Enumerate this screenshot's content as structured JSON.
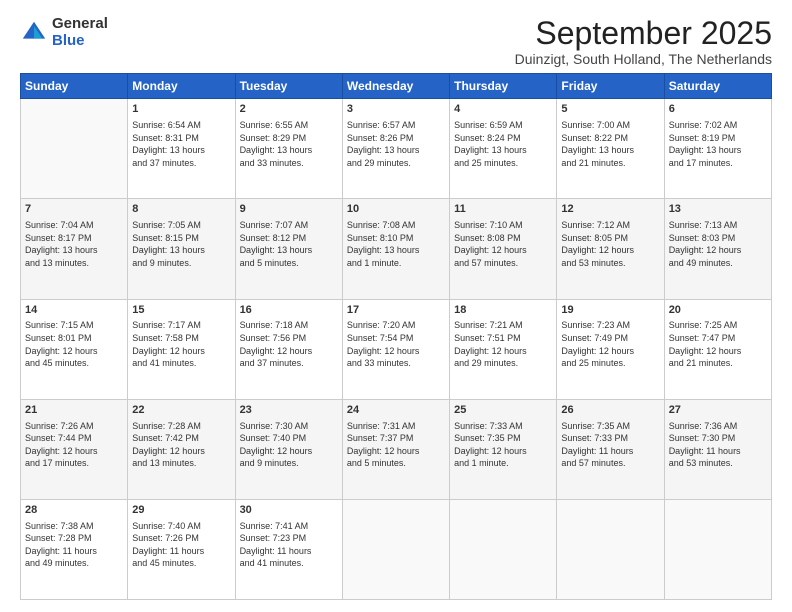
{
  "logo": {
    "general": "General",
    "blue": "Blue"
  },
  "title": "September 2025",
  "location": "Duinzigt, South Holland, The Netherlands",
  "days_of_week": [
    "Sunday",
    "Monday",
    "Tuesday",
    "Wednesday",
    "Thursday",
    "Friday",
    "Saturday"
  ],
  "weeks": [
    [
      {
        "num": "",
        "info": ""
      },
      {
        "num": "1",
        "info": "Sunrise: 6:54 AM\nSunset: 8:31 PM\nDaylight: 13 hours\nand 37 minutes."
      },
      {
        "num": "2",
        "info": "Sunrise: 6:55 AM\nSunset: 8:29 PM\nDaylight: 13 hours\nand 33 minutes."
      },
      {
        "num": "3",
        "info": "Sunrise: 6:57 AM\nSunset: 8:26 PM\nDaylight: 13 hours\nand 29 minutes."
      },
      {
        "num": "4",
        "info": "Sunrise: 6:59 AM\nSunset: 8:24 PM\nDaylight: 13 hours\nand 25 minutes."
      },
      {
        "num": "5",
        "info": "Sunrise: 7:00 AM\nSunset: 8:22 PM\nDaylight: 13 hours\nand 21 minutes."
      },
      {
        "num": "6",
        "info": "Sunrise: 7:02 AM\nSunset: 8:19 PM\nDaylight: 13 hours\nand 17 minutes."
      }
    ],
    [
      {
        "num": "7",
        "info": "Sunrise: 7:04 AM\nSunset: 8:17 PM\nDaylight: 13 hours\nand 13 minutes."
      },
      {
        "num": "8",
        "info": "Sunrise: 7:05 AM\nSunset: 8:15 PM\nDaylight: 13 hours\nand 9 minutes."
      },
      {
        "num": "9",
        "info": "Sunrise: 7:07 AM\nSunset: 8:12 PM\nDaylight: 13 hours\nand 5 minutes."
      },
      {
        "num": "10",
        "info": "Sunrise: 7:08 AM\nSunset: 8:10 PM\nDaylight: 13 hours\nand 1 minute."
      },
      {
        "num": "11",
        "info": "Sunrise: 7:10 AM\nSunset: 8:08 PM\nDaylight: 12 hours\nand 57 minutes."
      },
      {
        "num": "12",
        "info": "Sunrise: 7:12 AM\nSunset: 8:05 PM\nDaylight: 12 hours\nand 53 minutes."
      },
      {
        "num": "13",
        "info": "Sunrise: 7:13 AM\nSunset: 8:03 PM\nDaylight: 12 hours\nand 49 minutes."
      }
    ],
    [
      {
        "num": "14",
        "info": "Sunrise: 7:15 AM\nSunset: 8:01 PM\nDaylight: 12 hours\nand 45 minutes."
      },
      {
        "num": "15",
        "info": "Sunrise: 7:17 AM\nSunset: 7:58 PM\nDaylight: 12 hours\nand 41 minutes."
      },
      {
        "num": "16",
        "info": "Sunrise: 7:18 AM\nSunset: 7:56 PM\nDaylight: 12 hours\nand 37 minutes."
      },
      {
        "num": "17",
        "info": "Sunrise: 7:20 AM\nSunset: 7:54 PM\nDaylight: 12 hours\nand 33 minutes."
      },
      {
        "num": "18",
        "info": "Sunrise: 7:21 AM\nSunset: 7:51 PM\nDaylight: 12 hours\nand 29 minutes."
      },
      {
        "num": "19",
        "info": "Sunrise: 7:23 AM\nSunset: 7:49 PM\nDaylight: 12 hours\nand 25 minutes."
      },
      {
        "num": "20",
        "info": "Sunrise: 7:25 AM\nSunset: 7:47 PM\nDaylight: 12 hours\nand 21 minutes."
      }
    ],
    [
      {
        "num": "21",
        "info": "Sunrise: 7:26 AM\nSunset: 7:44 PM\nDaylight: 12 hours\nand 17 minutes."
      },
      {
        "num": "22",
        "info": "Sunrise: 7:28 AM\nSunset: 7:42 PM\nDaylight: 12 hours\nand 13 minutes."
      },
      {
        "num": "23",
        "info": "Sunrise: 7:30 AM\nSunset: 7:40 PM\nDaylight: 12 hours\nand 9 minutes."
      },
      {
        "num": "24",
        "info": "Sunrise: 7:31 AM\nSunset: 7:37 PM\nDaylight: 12 hours\nand 5 minutes."
      },
      {
        "num": "25",
        "info": "Sunrise: 7:33 AM\nSunset: 7:35 PM\nDaylight: 12 hours\nand 1 minute."
      },
      {
        "num": "26",
        "info": "Sunrise: 7:35 AM\nSunset: 7:33 PM\nDaylight: 11 hours\nand 57 minutes."
      },
      {
        "num": "27",
        "info": "Sunrise: 7:36 AM\nSunset: 7:30 PM\nDaylight: 11 hours\nand 53 minutes."
      }
    ],
    [
      {
        "num": "28",
        "info": "Sunrise: 7:38 AM\nSunset: 7:28 PM\nDaylight: 11 hours\nand 49 minutes."
      },
      {
        "num": "29",
        "info": "Sunrise: 7:40 AM\nSunset: 7:26 PM\nDaylight: 11 hours\nand 45 minutes."
      },
      {
        "num": "30",
        "info": "Sunrise: 7:41 AM\nSunset: 7:23 PM\nDaylight: 11 hours\nand 41 minutes."
      },
      {
        "num": "",
        "info": ""
      },
      {
        "num": "",
        "info": ""
      },
      {
        "num": "",
        "info": ""
      },
      {
        "num": "",
        "info": ""
      }
    ]
  ]
}
